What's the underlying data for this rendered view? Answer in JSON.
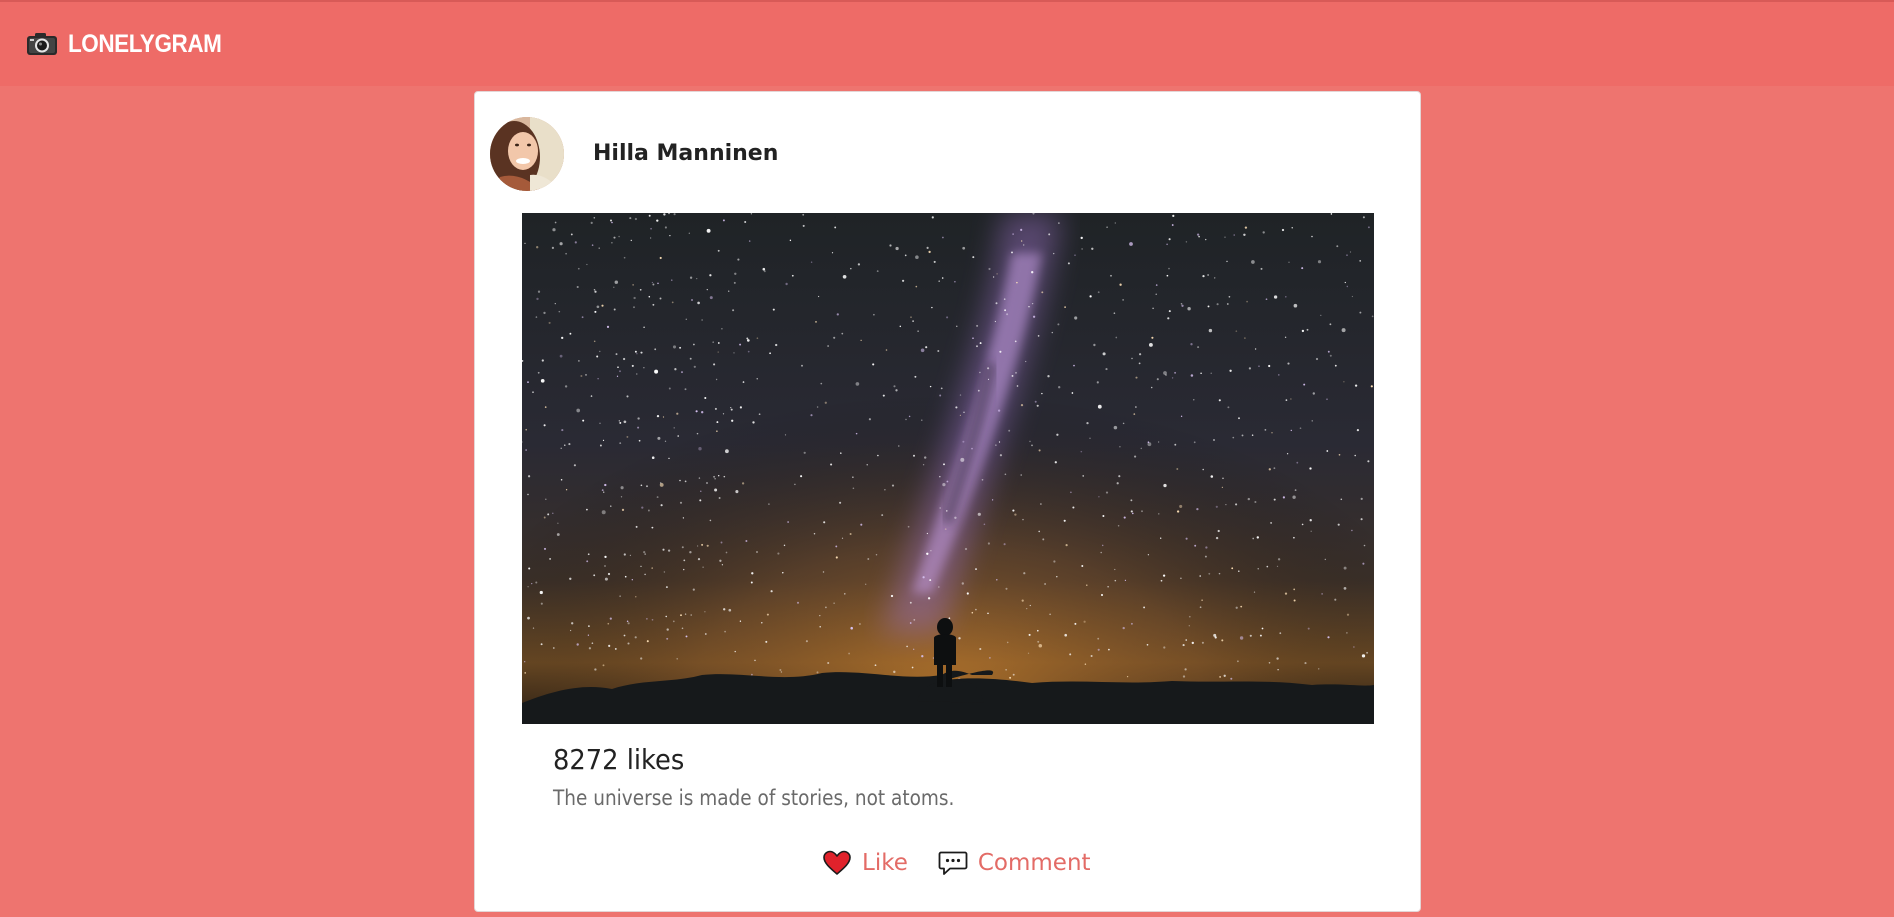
{
  "app": {
    "brand_name": "LONELYGRAM",
    "brand_icon": "camera-icon"
  },
  "post": {
    "author_name": "Hilla Manninen",
    "likes_text": "8272 likes",
    "caption": "The universe is made of stories, not atoms."
  },
  "actions": {
    "like_label": "Like",
    "like_icon": "heart-icon",
    "comment_label": "Comment",
    "comment_icon": "speech-bubble-icon"
  },
  "colors": {
    "background": "#ee746f",
    "navbar": "#ee6b67",
    "card": "#ffffff",
    "accent": "#e36b66",
    "heart": "#e0222b"
  }
}
